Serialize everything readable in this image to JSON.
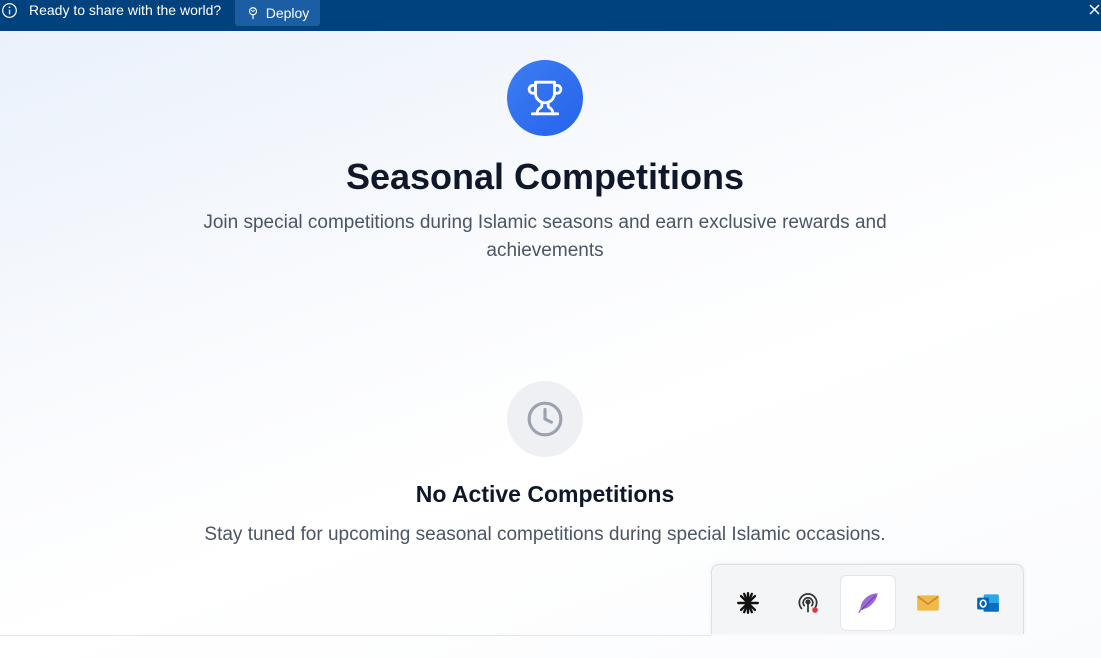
{
  "banner": {
    "message": "Ready to share with the world?",
    "deploy_label": "Deploy",
    "info_icon": "info-icon",
    "close_icon": "close-icon",
    "background": "#00427d"
  },
  "hero": {
    "icon": "trophy-icon",
    "title": "Seasonal Competitions",
    "subtitle": "Join special competitions during Islamic seasons and earn exclusive rewards and achievements",
    "accent": "#2563eb"
  },
  "empty_state": {
    "icon": "clock-icon",
    "title": "No Active Competitions",
    "message": "Stay tuned for upcoming seasonal competitions during special Islamic occasions."
  },
  "taskbar": {
    "items": [
      {
        "icon": "asterisk-app-icon"
      },
      {
        "icon": "podcast-app-icon"
      },
      {
        "icon": "feather-app-icon",
        "active": true
      },
      {
        "icon": "mail-app-icon"
      },
      {
        "icon": "outlook-app-icon"
      }
    ]
  }
}
